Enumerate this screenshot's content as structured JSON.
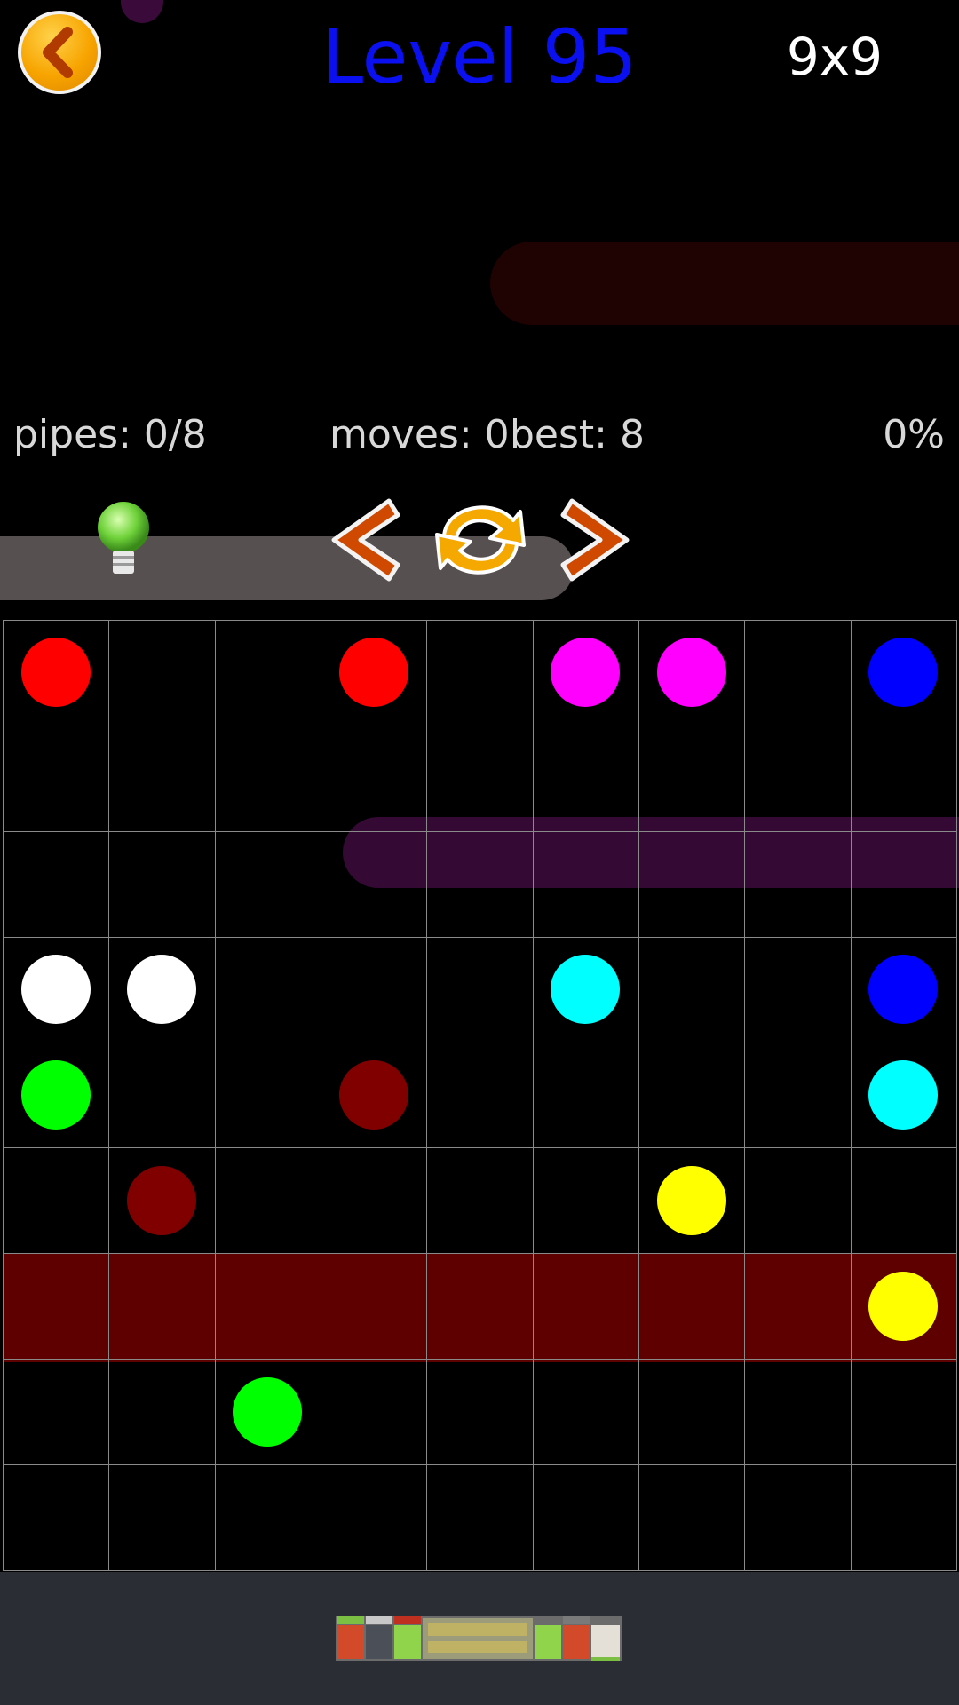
{
  "header": {
    "title": "Level 95",
    "grid_size": "9x9",
    "back_icon": "chevron-left-icon"
  },
  "stats": {
    "pipes": "pipes: 0/8",
    "moves": "moves: 0",
    "best": "best: 8",
    "progress": "0%"
  },
  "controls": {
    "hint_icon": "lightbulb-icon",
    "prev_icon": "chevron-left-icon",
    "restart_icon": "restart-icon",
    "next_icon": "chevron-right-icon"
  },
  "colors": {
    "red": "#ff0000",
    "magenta": "#ff00ff",
    "blue": "#0000ff",
    "white": "#ffffff",
    "cyan": "#00ffff",
    "green": "#00ff00",
    "maroon": "#800000",
    "yellow": "#ffff00",
    "grid_line": "#8a8a8a",
    "title": "#0b10f0",
    "highlight_row": "#5e0000"
  },
  "board": {
    "rows": 9,
    "cols": 9,
    "highlighted_row": 6,
    "dots": [
      {
        "row": 0,
        "col": 0,
        "color": "red"
      },
      {
        "row": 0,
        "col": 3,
        "color": "red"
      },
      {
        "row": 0,
        "col": 5,
        "color": "magenta"
      },
      {
        "row": 0,
        "col": 6,
        "color": "magenta"
      },
      {
        "row": 0,
        "col": 8,
        "color": "blue"
      },
      {
        "row": 3,
        "col": 0,
        "color": "white"
      },
      {
        "row": 3,
        "col": 1,
        "color": "white"
      },
      {
        "row": 3,
        "col": 5,
        "color": "cyan"
      },
      {
        "row": 3,
        "col": 8,
        "color": "blue"
      },
      {
        "row": 4,
        "col": 0,
        "color": "green"
      },
      {
        "row": 4,
        "col": 3,
        "color": "maroon"
      },
      {
        "row": 4,
        "col": 8,
        "color": "cyan"
      },
      {
        "row": 5,
        "col": 1,
        "color": "maroon"
      },
      {
        "row": 5,
        "col": 6,
        "color": "yellow"
      },
      {
        "row": 6,
        "col": 8,
        "color": "yellow"
      },
      {
        "row": 7,
        "col": 2,
        "color": "green"
      }
    ]
  },
  "footer": {
    "banner_icon": "square-rush-ad-banner"
  }
}
